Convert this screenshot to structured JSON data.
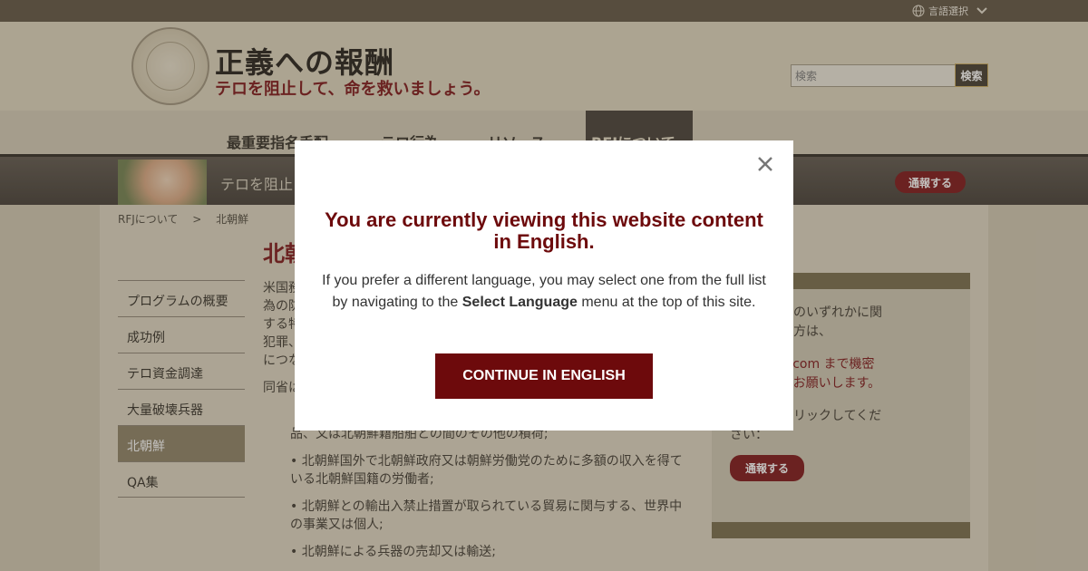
{
  "topbar": {
    "language_label": "言語選択"
  },
  "header": {
    "title": "正義への報酬",
    "tagline": "テロを阻止して、命を救いましょう。",
    "search_placeholder": "検索",
    "search_button": "検索"
  },
  "nav": {
    "items": [
      "最重要指名手配",
      "テロ行為",
      "リソース",
      "RFJについて"
    ]
  },
  "banner": {
    "text": "テロを阻止",
    "report_button": "通報する"
  },
  "breadcrumb": {
    "parent": "RFJについて",
    "separator": ">",
    "current": "北朝鮮"
  },
  "page": {
    "title": "北朝",
    "para1_lines": [
      "米国務",
      "為の防",
      "する特",
      "犯罪、",
      "につな"
    ],
    "para2": "同省は",
    "bullet1_line2": "品、又は北朝鮮籍船舶との間のその他の積荷;",
    "bullets": [
      "• 北朝鮮国外で北朝鮮政府又は朝鮮労働党のために多額の収入を得ている北朝鮮国籍の労働者;",
      "• 北朝鮮との輸出入禁止措置が取られている貿易に関与する、世界中の事業又は個人;",
      "• 北朝鮮による兵器の売却又は輸送;"
    ]
  },
  "sidebar": {
    "items": [
      "プログラムの概要",
      "成功例",
      "テロ資金調達",
      "大量破壊兵器",
      "北朝鮮",
      "QA集"
    ],
    "active_index": 4
  },
  "rightbox": {
    "line1": "ている活動のいずれかに関",
    "line2": "をお持ちの方は、",
    "email_line": "@dosinfo.com まで機密",
    "line4": "して送信をお願いします。",
    "line5": "こちらをクリックしてくだ",
    "line6": "さい：",
    "report_button": "通報する"
  },
  "modal": {
    "title": "You are currently viewing this website content in English.",
    "body_prefix": "If you prefer a different language, you may select one from the full list by navigating to the ",
    "body_bold": "Select Language",
    "body_suffix": " menu at the top of this site.",
    "continue_button": "CONTINUE IN ENGLISH"
  },
  "colors": {
    "accent": "#6d0a0c",
    "topbar": "#5b4f3d"
  }
}
